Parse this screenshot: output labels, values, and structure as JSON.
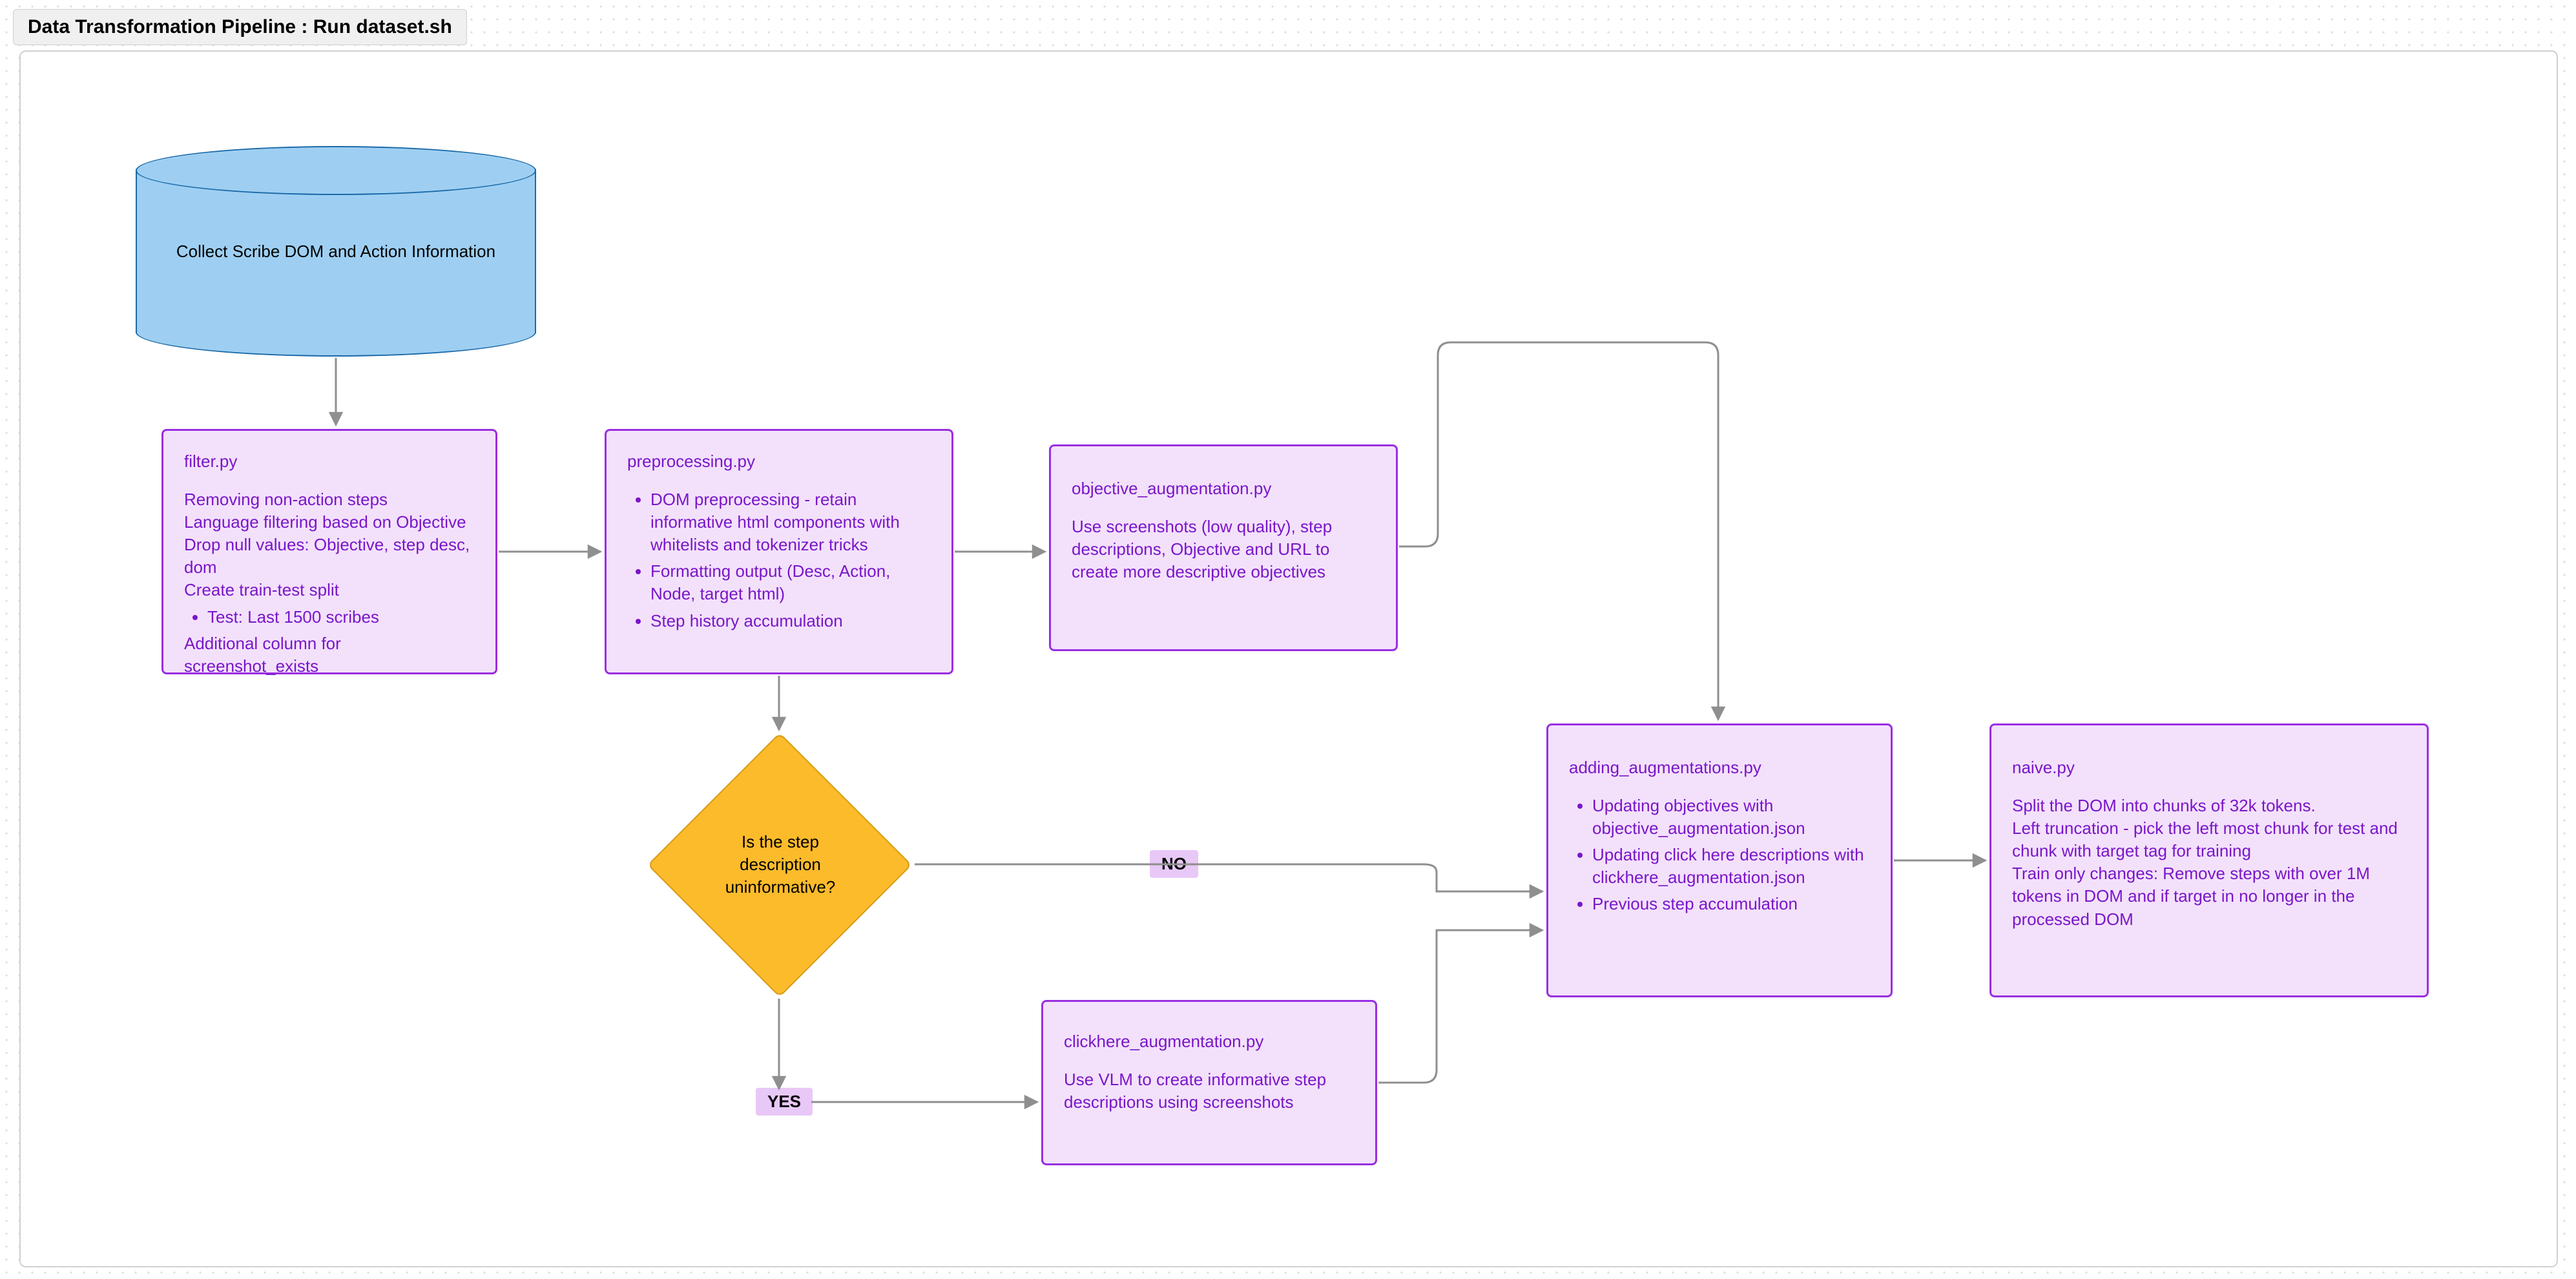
{
  "title": "Data Transformation Pipeline : Run dataset.sh",
  "cylinder": {
    "label": "Collect Scribe DOM and Action Information"
  },
  "nodes": {
    "filter": {
      "title": "filter.py",
      "l1": "Removing non-action steps",
      "l2": "Language filtering based on Objective",
      "l3": "Drop null values: Objective, step desc, dom",
      "l4": "Create train-test split",
      "b1": "Test: Last 1500 scribes",
      "l5": "Additional column for screenshot_exists"
    },
    "preprocessing": {
      "title": "preprocessing.py",
      "b1": "DOM preprocessing - retain informative html components with whitelists and tokenizer tricks",
      "b2": "Formatting output (Desc, Action, Node, target html)",
      "b3": "Step history accumulation"
    },
    "objective_aug": {
      "title": "objective_augmentation.py",
      "body": "Use screenshots (low quality), step descriptions, Objective and URL to create more descriptive objectives"
    },
    "clickhere_aug": {
      "title": "clickhere_augmentation.py",
      "body": "Use VLM  to create informative step descriptions using screenshots"
    },
    "adding_aug": {
      "title": "adding_augmentations.py",
      "b1": "Updating objectives with objective_augmentation.json",
      "b2": "Updating click here descriptions with clickhere_augmentation.json",
      "b3": "Previous step accumulation"
    },
    "naive": {
      "title": "naive.py",
      "l1": "Split the DOM into chunks of 32k tokens.",
      "l2": "Left truncation - pick the left most chunk for test and chunk with target tag for training",
      "l3": "Train only changes: Remove steps with over 1M tokens in DOM and if target in no longer in the processed DOM"
    }
  },
  "decision": {
    "text_l1": "Is the step",
    "text_l2": "description",
    "text_l3": "uninformative?",
    "yes": "YES",
    "no": "NO"
  },
  "chart_data": {
    "type": "flowchart",
    "title": "Data Transformation Pipeline : Run dataset.sh",
    "nodes": [
      {
        "id": "collect",
        "type": "datastore",
        "label": "Collect Scribe DOM and Action Information"
      },
      {
        "id": "filter",
        "type": "process",
        "label": "filter.py"
      },
      {
        "id": "preprocess",
        "type": "process",
        "label": "preprocessing.py"
      },
      {
        "id": "obj_aug",
        "type": "process",
        "label": "objective_augmentation.py"
      },
      {
        "id": "decision",
        "type": "decision",
        "label": "Is the step description uninformative?"
      },
      {
        "id": "click_aug",
        "type": "process",
        "label": "clickhere_augmentation.py"
      },
      {
        "id": "add_aug",
        "type": "process",
        "label": "adding_augmentations.py"
      },
      {
        "id": "naive",
        "type": "process",
        "label": "naive.py"
      }
    ],
    "edges": [
      {
        "from": "collect",
        "to": "filter"
      },
      {
        "from": "filter",
        "to": "preprocess"
      },
      {
        "from": "preprocess",
        "to": "obj_aug"
      },
      {
        "from": "preprocess",
        "to": "decision"
      },
      {
        "from": "decision",
        "to": "add_aug",
        "label": "NO"
      },
      {
        "from": "decision",
        "to": "click_aug",
        "label": "YES"
      },
      {
        "from": "click_aug",
        "to": "add_aug"
      },
      {
        "from": "obj_aug",
        "to": "add_aug"
      },
      {
        "from": "add_aug",
        "to": "naive"
      }
    ]
  }
}
